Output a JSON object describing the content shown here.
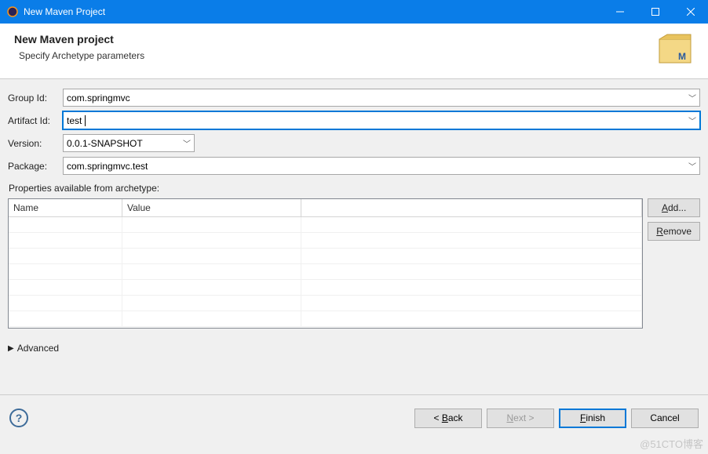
{
  "window": {
    "title": "New Maven Project"
  },
  "header": {
    "title": "New Maven project",
    "subtitle": "Specify Archetype parameters"
  },
  "form": {
    "groupId": {
      "label": "Group Id:",
      "value": "com.springmvc"
    },
    "artifactId": {
      "label": "Artifact Id:",
      "value": "test"
    },
    "version": {
      "label": "Version:",
      "value": "0.0.1-SNAPSHOT"
    },
    "package": {
      "label": "Package:",
      "value": "com.springmvc.test"
    }
  },
  "properties": {
    "label": "Properties available from archetype:",
    "columns": {
      "name": "Name",
      "value": "Value"
    },
    "rows": []
  },
  "buttons": {
    "add": "Add...",
    "remove": "Remove"
  },
  "advanced": {
    "label": "Advanced"
  },
  "footer": {
    "back": "Back",
    "next": "Next >",
    "finish": "Finish",
    "cancel": "Cancel"
  },
  "watermark": "@51CTO博客"
}
